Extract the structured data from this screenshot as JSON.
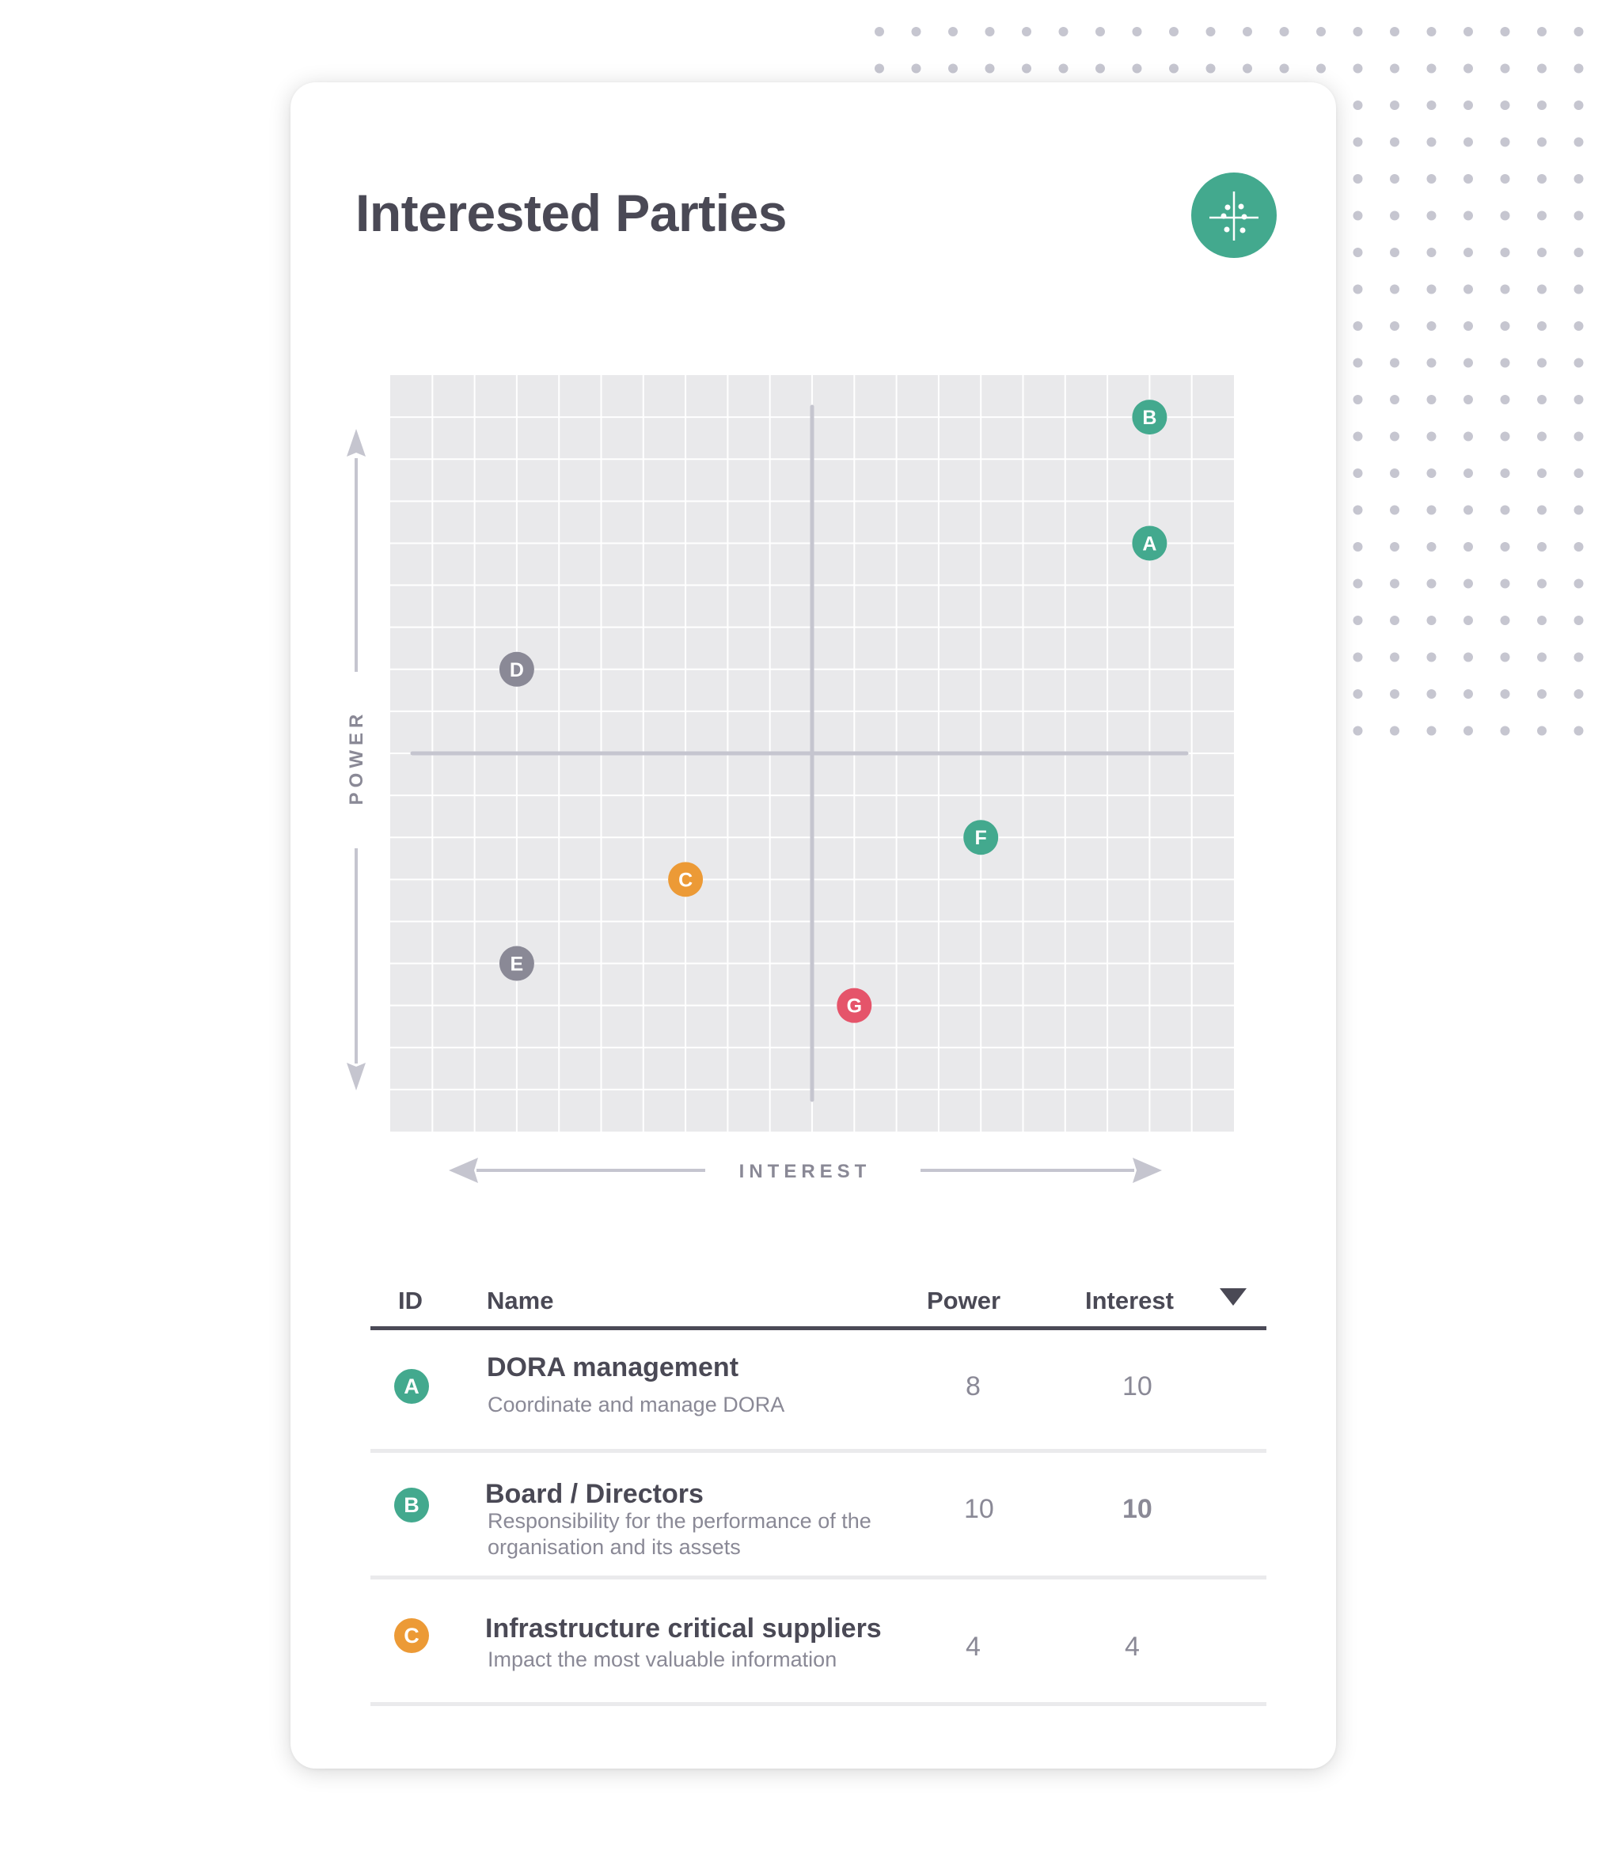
{
  "title": "Interested Parties",
  "matrix_button": {
    "icon": "power-interest-matrix-icon"
  },
  "colors": {
    "green": "#43a98e",
    "orange": "#ec9a36",
    "red": "#e5546a",
    "gray": "#8a8996",
    "grid_bg": "#e9e9eb",
    "axis": "#c5c5cf",
    "text_dark": "#4a4955"
  },
  "chart_data": {
    "type": "scatter",
    "title": "",
    "xlabel": "INTEREST",
    "ylabel": "POWER",
    "xlim": [
      0,
      20
    ],
    "ylim": [
      0,
      18
    ],
    "grid": true,
    "quadrant_divider": {
      "x": 10,
      "y": 9
    },
    "points": [
      {
        "id": "B",
        "x": 18,
        "y": 17,
        "color": "green"
      },
      {
        "id": "A",
        "x": 18,
        "y": 14,
        "color": "green"
      },
      {
        "id": "D",
        "x": 3,
        "y": 11,
        "color": "gray"
      },
      {
        "id": "F",
        "x": 14,
        "y": 7,
        "color": "green"
      },
      {
        "id": "C",
        "x": 7,
        "y": 6,
        "color": "orange"
      },
      {
        "id": "E",
        "x": 3,
        "y": 4,
        "color": "gray"
      },
      {
        "id": "G",
        "x": 11,
        "y": 3,
        "color": "red"
      }
    ]
  },
  "table": {
    "headers": {
      "id": "ID",
      "name": "Name",
      "power": "Power",
      "interest": "Interest"
    },
    "sort_icon": "sort-descending-icon",
    "rows": [
      {
        "id": "A",
        "color": "green",
        "name": "DORA management",
        "description": "Coordinate and manage DORA",
        "power": "8",
        "interest": "10",
        "interest_bold": false
      },
      {
        "id": "B",
        "color": "green",
        "name": "Board / Directors",
        "description": "Responsibility for the performance of the organisation and its assets",
        "power": "10",
        "interest": "10",
        "interest_bold": true
      },
      {
        "id": "C",
        "color": "orange",
        "name": "Infrastructure critical suppliers",
        "description": "Impact the most valuable information",
        "power": "4",
        "interest": "4",
        "interest_bold": false
      }
    ]
  }
}
